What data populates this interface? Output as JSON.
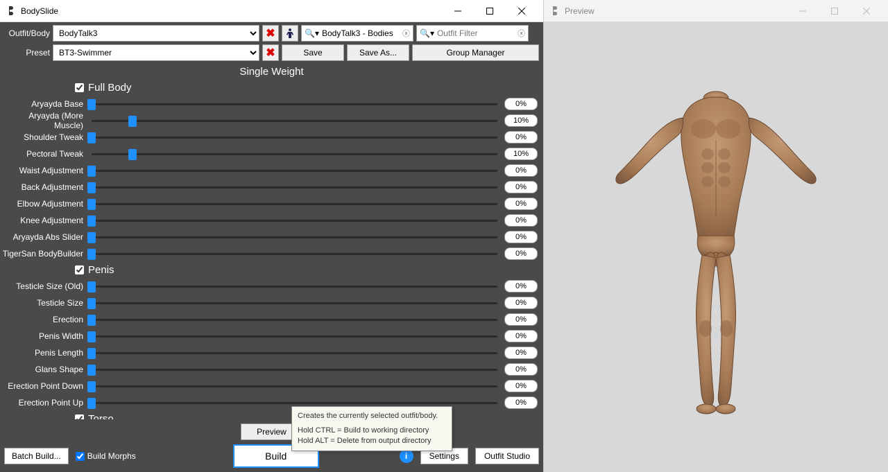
{
  "main_window": {
    "title": "BodySlide",
    "outfit_label": "Outfit/Body",
    "preset_label": "Preset",
    "outfit_selected": "BodyTalk3",
    "preset_selected": "BT3-Swimmer",
    "group_filter_value": "BodyTalk3 - Bodies",
    "outfit_filter_placeholder": "Outfit Filter",
    "save_btn": "Save",
    "save_as_btn": "Save As...",
    "group_manager_btn": "Group Manager",
    "weight_header": "Single Weight"
  },
  "groups": [
    {
      "name": "Full Body",
      "checked": true,
      "sliders": [
        {
          "label": "Aryayda Base",
          "value": 0
        },
        {
          "label": "Aryayda (More Muscle)",
          "value": 10
        },
        {
          "label": "Shoulder Tweak",
          "value": 0
        },
        {
          "label": "Pectoral Tweak",
          "value": 10
        },
        {
          "label": "Waist Adjustment",
          "value": 0
        },
        {
          "label": "Back Adjustment",
          "value": 0
        },
        {
          "label": "Elbow Adjustment",
          "value": 0
        },
        {
          "label": "Knee Adjustment",
          "value": 0
        },
        {
          "label": "Aryayda Abs Slider",
          "value": 0
        },
        {
          "label": "TigerSan BodyBuilder",
          "value": 0
        }
      ]
    },
    {
      "name": "Penis",
      "checked": true,
      "sliders": [
        {
          "label": "Testicle Size (Old)",
          "value": 0
        },
        {
          "label": "Testicle Size",
          "value": 0
        },
        {
          "label": "Erection",
          "value": 0
        },
        {
          "label": "Penis Width",
          "value": 0
        },
        {
          "label": "Penis Length",
          "value": 0
        },
        {
          "label": "Glans Shape",
          "value": 0
        },
        {
          "label": "Erection Point Down",
          "value": 0
        },
        {
          "label": "Erection Point Up",
          "value": 0
        }
      ]
    },
    {
      "name": "Torso",
      "checked": true,
      "sliders": []
    }
  ],
  "bottom": {
    "preview_btn": "Preview",
    "batch_build_btn": "Batch Build...",
    "build_morphs_label": "Build Morphs",
    "build_btn": "Build",
    "settings_btn": "Settings",
    "outfit_studio_btn": "Outfit Studio"
  },
  "tooltip": {
    "line1": "Creates the currently selected outfit/body.",
    "line2": "Hold CTRL = Build to working directory",
    "line3": "Hold ALT = Delete from output directory"
  },
  "preview_window": {
    "title": "Preview"
  }
}
